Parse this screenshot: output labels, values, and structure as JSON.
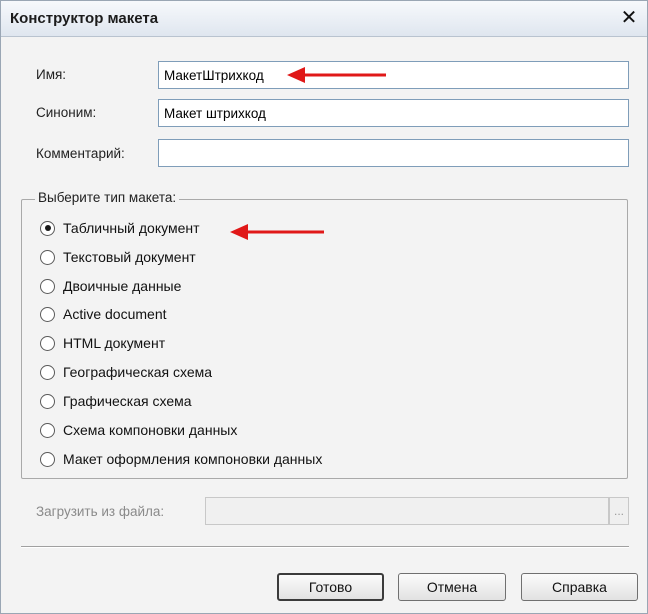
{
  "dialog": {
    "title": "Конструктор макета",
    "close_glyph": "✕"
  },
  "form": {
    "name_label": "Имя:",
    "name_value": "МакетШтрихкод",
    "synonym_label": "Синоним:",
    "synonym_value": "Макет штрихкод",
    "comment_label": "Комментарий:",
    "comment_value": ""
  },
  "template_type": {
    "legend": "Выберите тип макета:",
    "options": [
      {
        "label": "Табличный документ",
        "selected": true
      },
      {
        "label": "Текстовый документ",
        "selected": false
      },
      {
        "label": "Двоичные данные",
        "selected": false
      },
      {
        "label": "Active document",
        "selected": false
      },
      {
        "label": "HTML документ",
        "selected": false
      },
      {
        "label": "Географическая схема",
        "selected": false
      },
      {
        "label": "Графическая схема",
        "selected": false
      },
      {
        "label": "Схема компоновки данных",
        "selected": false
      },
      {
        "label": "Макет оформления компоновки данных",
        "selected": false
      }
    ]
  },
  "load": {
    "label": "Загрузить из файла:",
    "value": "",
    "browse_glyph": "..."
  },
  "buttons": {
    "ok": "Готово",
    "cancel": "Отмена",
    "help": "Справка"
  },
  "annotations": {
    "arrow_color": "#e01818"
  }
}
